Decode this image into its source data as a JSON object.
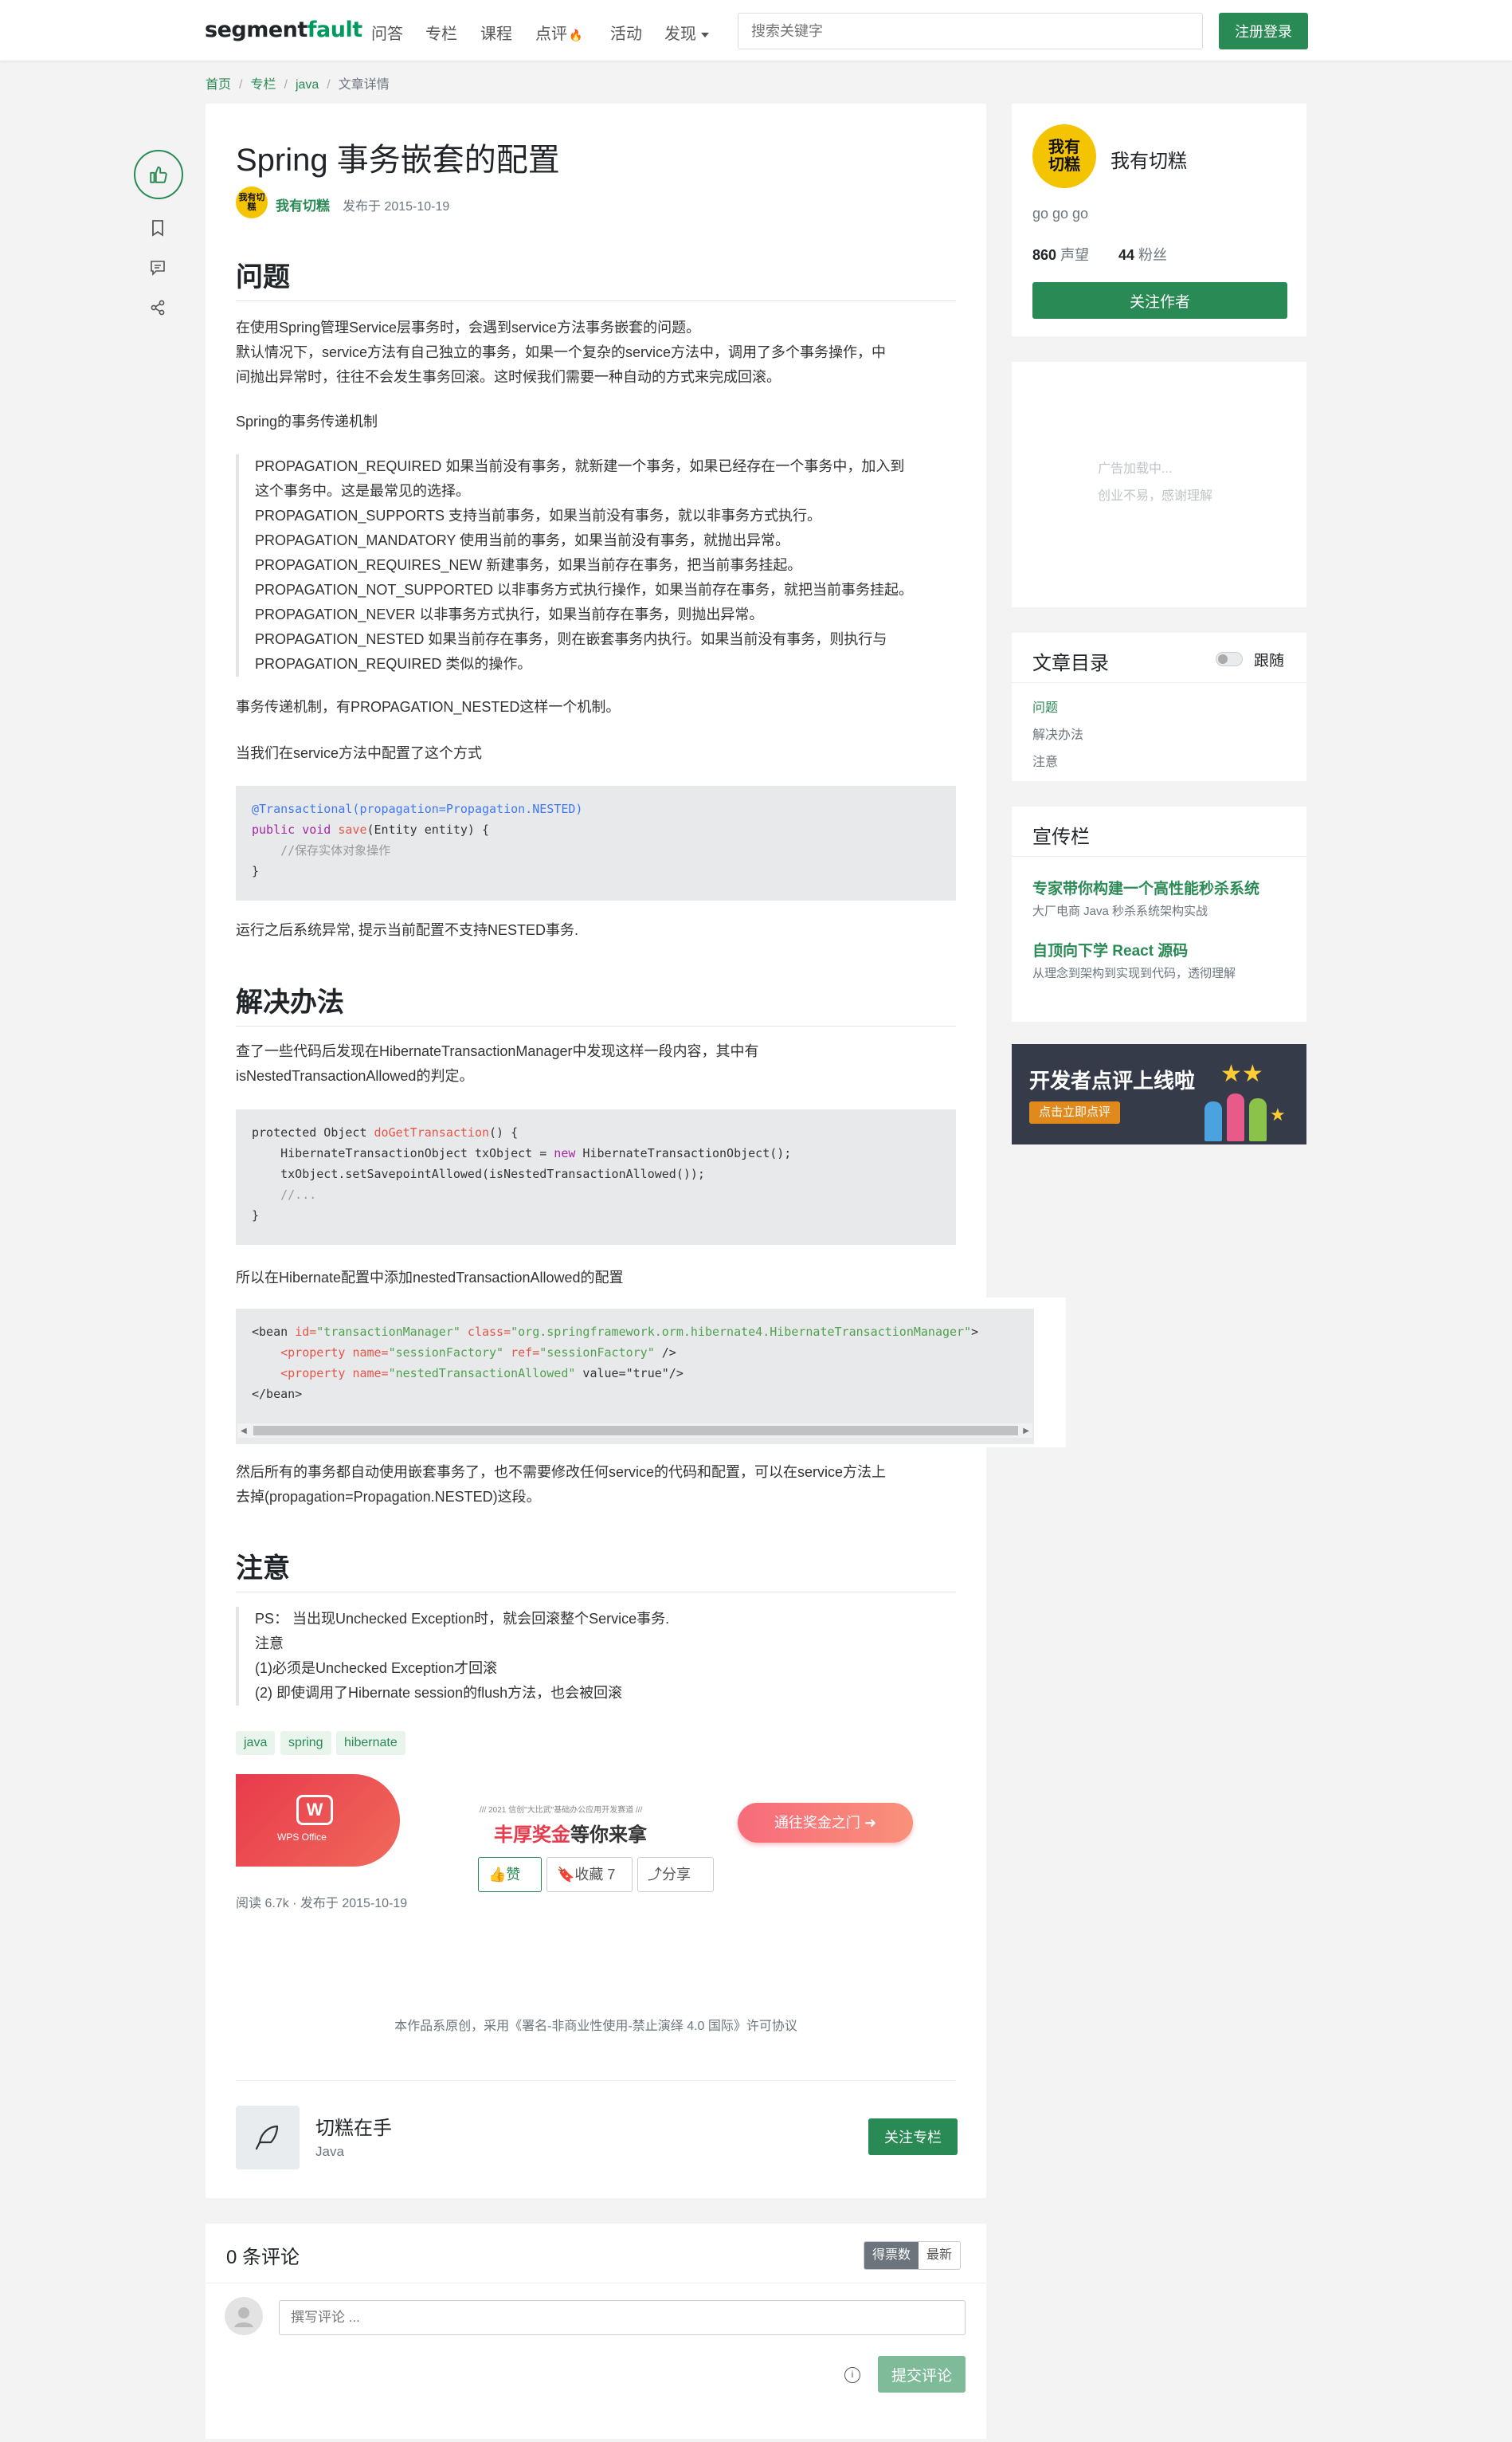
{
  "header": {
    "logo_a": "segment",
    "logo_b": "fault",
    "nav": [
      "问答",
      "专栏",
      "课程",
      "点评",
      "活动",
      "发现"
    ],
    "search_placeholder": "搜索关键字",
    "register_label": "注册登录"
  },
  "breadcrumb": [
    "首页",
    "专栏",
    "java",
    "文章详情"
  ],
  "article": {
    "title": "Spring 事务嵌套的配置",
    "author": "我有切糕",
    "date": "发布于 2015-10-19",
    "h_problem": "问题",
    "p1": "在使用Spring管理Service层事务时，会遇到service方法事务嵌套的问题。",
    "p2a": "默认情况下，service方法有自己独立的事务，如果一个复杂的service方法中，调用了多个事务操作，中",
    "p2b": "间抛出异常时，往往不会发生事务回滚。这时候我们需要一种自动的方式来完成回滚。",
    "p3": "Spring的事务传递机制",
    "q1a": "PROPAGATION_REQUIRED 如果当前没有事务，就新建一个事务，如果已经存在一个事务中，加入到",
    "q1b": "这个事务中。这是最常见的选择。",
    "q2": "PROPAGATION_SUPPORTS 支持当前事务，如果当前没有事务，就以非事务方式执行。",
    "q3": "PROPAGATION_MANDATORY 使用当前的事务，如果当前没有事务，就抛出异常。",
    "q4": "PROPAGATION_REQUIRES_NEW 新建事务，如果当前存在事务，把当前事务挂起。",
    "q5": "PROPAGATION_NOT_SUPPORTED 以非事务方式执行操作，如果当前存在事务，就把当前事务挂起。",
    "q6": "PROPAGATION_NEVER 以非事务方式执行，如果当前存在事务，则抛出异常。",
    "q7a": "PROPAGATION_NESTED 如果当前存在事务，则在嵌套事务内执行。如果当前没有事务，则执行与",
    "q7b": "PROPAGATION_REQUIRED 类似的操作。",
    "p4": "事务传递机制，有PROPAGATION_NESTED这样一个机制。",
    "p5": "当我们在service方法中配置了这个方式",
    "code1": {
      "l1": "@Transactional(propagation=Propagation.NESTED)",
      "l2_kw": "public void ",
      "l2_fn": "save",
      "l2_rest": "(Entity entity) {",
      "l3": "    //保存实体对象操作",
      "l4": "}"
    },
    "p6": "运行之后系统异常, 提示当前配置不支持NESTED事务.",
    "h_solution": "解决办法",
    "p7a": "查了一些代码后发现在HibernateTransactionManager中发现这样一段内容，其中有",
    "p7b": "isNestedTransactionAllowed的判定。",
    "code2": {
      "l1a": "protected Object ",
      "l1b": "doGetTransaction",
      "l1c": "() {",
      "l2a": "    HibernateTransactionObject txObject = ",
      "l2b": "new",
      "l2c": " HibernateTransactionObject();",
      "l3": "    txObject.setSavepointAllowed(isNestedTransactionAllowed());",
      "l4": "    //...",
      "l5": "}"
    },
    "p8": "所以在Hibernate配置中添加nestedTransactionAllowed的配置",
    "code3": {
      "l1a": "<bean ",
      "l1b": "id=",
      "l1c": "\"transactionManager\"",
      "l1d": " class=",
      "l1e": "\"org.springframework.orm.hibernate4.HibernateTransactionManager\"",
      "l1f": ">",
      "l2a": "    <property ",
      "l2b": "name=",
      "l2c": "\"sessionFactory\"",
      "l2d": " ref=",
      "l2e": "\"sessionFactory\"",
      "l2f": " />",
      "l3a": "    <property ",
      "l3b": "name=",
      "l3c": "\"nestedTransactionAllowed\"",
      "l3d": " value=\"true\"/>",
      "l4": "</bean>"
    },
    "p9a": "然后所有的事务都自动使用嵌套事务了，也不需要修改任何service的代码和配置，可以在service方法上",
    "p9b": "去掉(propagation=Propagation.NESTED)这段。",
    "h_note": "注意",
    "n1": "PS： 当出现Unchecked Exception时，就会回滚整个Service事务.",
    "n2": "注意",
    "n3": "(1)必须是Unchecked Exception才回滚",
    "n4": "(2) 即使调用了Hibernate session的flush方法，也会被回滚",
    "tags": [
      "java",
      "spring",
      "hibernate"
    ],
    "ad_top": "/// 2021 信创\"大比武\"基础办公应用开发赛道 ///",
    "ad_main_red": "丰厚奖金",
    "ad_main_rest": "等你来拿",
    "ad_btn": "通往奖金之门",
    "ad_logo": "WPS Office",
    "stats": "阅读 6.7k · 发布于 2015-10-19",
    "like_label": "赞",
    "fav_label": "收藏 7",
    "share_label": "分享",
    "license": "本作品系原创，采用《署名-非商业性使用-禁止演绎 4.0 国际》许可协议",
    "column_name": "切糕在手",
    "column_sub": "Java",
    "follow_column": "关注专栏"
  },
  "author_card": {
    "name": "我有切糕",
    "bio": "go go go",
    "rep_num": "860",
    "rep_label": "声望",
    "fans_num": "44",
    "fans_label": "粉丝",
    "follow_label": "关注作者",
    "avatar_text": "我有切糕"
  },
  "ad_card": {
    "line1": "广告加载中...",
    "line2": "创业不易，感谢理解"
  },
  "toc": {
    "title": "文章目录",
    "follow": "跟随",
    "items": [
      "问题",
      "解决办法",
      "注意"
    ]
  },
  "promo": {
    "title": "宣传栏",
    "i1_title": "专家带你构建一个高性能秒杀系统",
    "i1_sub": "大厂电商 Java 秒杀系统架构实战",
    "i2_title": "自顶向下学 React 源码",
    "i2_sub": "从理念到架构到实现到代码，透彻理解"
  },
  "banner": {
    "title": "开发者点评上线啦",
    "btn": "点击立即点评"
  },
  "comments": {
    "count": "0 条评论",
    "sort_hot": "得票数",
    "sort_new": "最新",
    "placeholder": "撰写评论 ...",
    "submit": "提交评论"
  },
  "colors": {
    "brand": "#2a8a55",
    "link": "#2a8a55"
  }
}
